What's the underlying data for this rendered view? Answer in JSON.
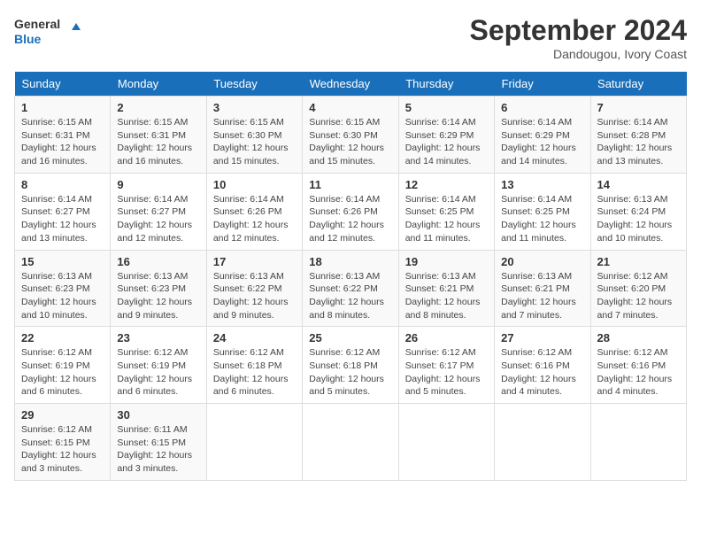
{
  "header": {
    "logo_line1": "General",
    "logo_line2": "Blue",
    "month": "September 2024",
    "location": "Dandougou, Ivory Coast"
  },
  "days_of_week": [
    "Sunday",
    "Monday",
    "Tuesday",
    "Wednesday",
    "Thursday",
    "Friday",
    "Saturday"
  ],
  "weeks": [
    [
      {
        "day": "1",
        "sunrise": "6:15 AM",
        "sunset": "6:31 PM",
        "daylight": "12 hours and 16 minutes."
      },
      {
        "day": "2",
        "sunrise": "6:15 AM",
        "sunset": "6:31 PM",
        "daylight": "12 hours and 16 minutes."
      },
      {
        "day": "3",
        "sunrise": "6:15 AM",
        "sunset": "6:30 PM",
        "daylight": "12 hours and 15 minutes."
      },
      {
        "day": "4",
        "sunrise": "6:15 AM",
        "sunset": "6:30 PM",
        "daylight": "12 hours and 15 minutes."
      },
      {
        "day": "5",
        "sunrise": "6:14 AM",
        "sunset": "6:29 PM",
        "daylight": "12 hours and 14 minutes."
      },
      {
        "day": "6",
        "sunrise": "6:14 AM",
        "sunset": "6:29 PM",
        "daylight": "12 hours and 14 minutes."
      },
      {
        "day": "7",
        "sunrise": "6:14 AM",
        "sunset": "6:28 PM",
        "daylight": "12 hours and 13 minutes."
      }
    ],
    [
      {
        "day": "8",
        "sunrise": "6:14 AM",
        "sunset": "6:27 PM",
        "daylight": "12 hours and 13 minutes."
      },
      {
        "day": "9",
        "sunrise": "6:14 AM",
        "sunset": "6:27 PM",
        "daylight": "12 hours and 12 minutes."
      },
      {
        "day": "10",
        "sunrise": "6:14 AM",
        "sunset": "6:26 PM",
        "daylight": "12 hours and 12 minutes."
      },
      {
        "day": "11",
        "sunrise": "6:14 AM",
        "sunset": "6:26 PM",
        "daylight": "12 hours and 12 minutes."
      },
      {
        "day": "12",
        "sunrise": "6:14 AM",
        "sunset": "6:25 PM",
        "daylight": "12 hours and 11 minutes."
      },
      {
        "day": "13",
        "sunrise": "6:14 AM",
        "sunset": "6:25 PM",
        "daylight": "12 hours and 11 minutes."
      },
      {
        "day": "14",
        "sunrise": "6:13 AM",
        "sunset": "6:24 PM",
        "daylight": "12 hours and 10 minutes."
      }
    ],
    [
      {
        "day": "15",
        "sunrise": "6:13 AM",
        "sunset": "6:23 PM",
        "daylight": "12 hours and 10 minutes."
      },
      {
        "day": "16",
        "sunrise": "6:13 AM",
        "sunset": "6:23 PM",
        "daylight": "12 hours and 9 minutes."
      },
      {
        "day": "17",
        "sunrise": "6:13 AM",
        "sunset": "6:22 PM",
        "daylight": "12 hours and 9 minutes."
      },
      {
        "day": "18",
        "sunrise": "6:13 AM",
        "sunset": "6:22 PM",
        "daylight": "12 hours and 8 minutes."
      },
      {
        "day": "19",
        "sunrise": "6:13 AM",
        "sunset": "6:21 PM",
        "daylight": "12 hours and 8 minutes."
      },
      {
        "day": "20",
        "sunrise": "6:13 AM",
        "sunset": "6:21 PM",
        "daylight": "12 hours and 7 minutes."
      },
      {
        "day": "21",
        "sunrise": "6:12 AM",
        "sunset": "6:20 PM",
        "daylight": "12 hours and 7 minutes."
      }
    ],
    [
      {
        "day": "22",
        "sunrise": "6:12 AM",
        "sunset": "6:19 PM",
        "daylight": "12 hours and 6 minutes."
      },
      {
        "day": "23",
        "sunrise": "6:12 AM",
        "sunset": "6:19 PM",
        "daylight": "12 hours and 6 minutes."
      },
      {
        "day": "24",
        "sunrise": "6:12 AM",
        "sunset": "6:18 PM",
        "daylight": "12 hours and 6 minutes."
      },
      {
        "day": "25",
        "sunrise": "6:12 AM",
        "sunset": "6:18 PM",
        "daylight": "12 hours and 5 minutes."
      },
      {
        "day": "26",
        "sunrise": "6:12 AM",
        "sunset": "6:17 PM",
        "daylight": "12 hours and 5 minutes."
      },
      {
        "day": "27",
        "sunrise": "6:12 AM",
        "sunset": "6:16 PM",
        "daylight": "12 hours and 4 minutes."
      },
      {
        "day": "28",
        "sunrise": "6:12 AM",
        "sunset": "6:16 PM",
        "daylight": "12 hours and 4 minutes."
      }
    ],
    [
      {
        "day": "29",
        "sunrise": "6:12 AM",
        "sunset": "6:15 PM",
        "daylight": "12 hours and 3 minutes."
      },
      {
        "day": "30",
        "sunrise": "6:11 AM",
        "sunset": "6:15 PM",
        "daylight": "12 hours and 3 minutes."
      },
      null,
      null,
      null,
      null,
      null
    ]
  ]
}
